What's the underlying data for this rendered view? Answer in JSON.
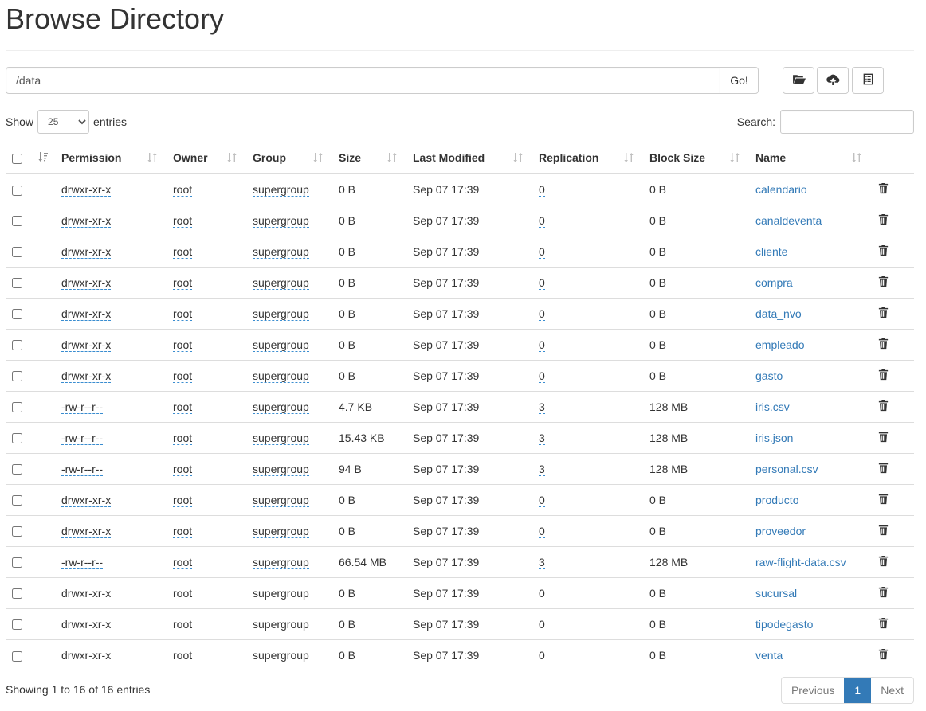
{
  "page": {
    "title": "Browse Directory"
  },
  "toolbar": {
    "path_value": "/data",
    "go_label": "Go!",
    "buttons": [
      {
        "icon": "folder-open-icon"
      },
      {
        "icon": "cloud-upload-icon"
      },
      {
        "icon": "list-alt-icon"
      }
    ]
  },
  "controls": {
    "show_label": "Show",
    "entries_value": "25",
    "entries_label": "entries",
    "search_label": "Search:"
  },
  "table": {
    "columns": [
      "Permission",
      "Owner",
      "Group",
      "Size",
      "Last Modified",
      "Replication",
      "Block Size",
      "Name"
    ],
    "rows": [
      {
        "permission": "drwxr-xr-x",
        "owner": "root",
        "group": "supergroup",
        "size": "0 B",
        "modified": "Sep 07 17:39",
        "replication": "0",
        "block_size": "0 B",
        "name": "calendario"
      },
      {
        "permission": "drwxr-xr-x",
        "owner": "root",
        "group": "supergroup",
        "size": "0 B",
        "modified": "Sep 07 17:39",
        "replication": "0",
        "block_size": "0 B",
        "name": "canaldeventa"
      },
      {
        "permission": "drwxr-xr-x",
        "owner": "root",
        "group": "supergroup",
        "size": "0 B",
        "modified": "Sep 07 17:39",
        "replication": "0",
        "block_size": "0 B",
        "name": "cliente"
      },
      {
        "permission": "drwxr-xr-x",
        "owner": "root",
        "group": "supergroup",
        "size": "0 B",
        "modified": "Sep 07 17:39",
        "replication": "0",
        "block_size": "0 B",
        "name": "compra"
      },
      {
        "permission": "drwxr-xr-x",
        "owner": "root",
        "group": "supergroup",
        "size": "0 B",
        "modified": "Sep 07 17:39",
        "replication": "0",
        "block_size": "0 B",
        "name": "data_nvo"
      },
      {
        "permission": "drwxr-xr-x",
        "owner": "root",
        "group": "supergroup",
        "size": "0 B",
        "modified": "Sep 07 17:39",
        "replication": "0",
        "block_size": "0 B",
        "name": "empleado"
      },
      {
        "permission": "drwxr-xr-x",
        "owner": "root",
        "group": "supergroup",
        "size": "0 B",
        "modified": "Sep 07 17:39",
        "replication": "0",
        "block_size": "0 B",
        "name": "gasto"
      },
      {
        "permission": "-rw-r--r--",
        "owner": "root",
        "group": "supergroup",
        "size": "4.7 KB",
        "modified": "Sep 07 17:39",
        "replication": "3",
        "block_size": "128 MB",
        "name": "iris.csv"
      },
      {
        "permission": "-rw-r--r--",
        "owner": "root",
        "group": "supergroup",
        "size": "15.43 KB",
        "modified": "Sep 07 17:39",
        "replication": "3",
        "block_size": "128 MB",
        "name": "iris.json"
      },
      {
        "permission": "-rw-r--r--",
        "owner": "root",
        "group": "supergroup",
        "size": "94 B",
        "modified": "Sep 07 17:39",
        "replication": "3",
        "block_size": "128 MB",
        "name": "personal.csv"
      },
      {
        "permission": "drwxr-xr-x",
        "owner": "root",
        "group": "supergroup",
        "size": "0 B",
        "modified": "Sep 07 17:39",
        "replication": "0",
        "block_size": "0 B",
        "name": "producto"
      },
      {
        "permission": "drwxr-xr-x",
        "owner": "root",
        "group": "supergroup",
        "size": "0 B",
        "modified": "Sep 07 17:39",
        "replication": "0",
        "block_size": "0 B",
        "name": "proveedor"
      },
      {
        "permission": "-rw-r--r--",
        "owner": "root",
        "group": "supergroup",
        "size": "66.54 MB",
        "modified": "Sep 07 17:39",
        "replication": "3",
        "block_size": "128 MB",
        "name": "raw-flight-data.csv"
      },
      {
        "permission": "drwxr-xr-x",
        "owner": "root",
        "group": "supergroup",
        "size": "0 B",
        "modified": "Sep 07 17:39",
        "replication": "0",
        "block_size": "0 B",
        "name": "sucursal"
      },
      {
        "permission": "drwxr-xr-x",
        "owner": "root",
        "group": "supergroup",
        "size": "0 B",
        "modified": "Sep 07 17:39",
        "replication": "0",
        "block_size": "0 B",
        "name": "tipodegasto"
      },
      {
        "permission": "drwxr-xr-x",
        "owner": "root",
        "group": "supergroup",
        "size": "0 B",
        "modified": "Sep 07 17:39",
        "replication": "0",
        "block_size": "0 B",
        "name": "venta"
      }
    ]
  },
  "footer": {
    "info": "Showing 1 to 16 of 16 entries",
    "previous": "Previous",
    "current_page": "1",
    "next": "Next"
  }
}
